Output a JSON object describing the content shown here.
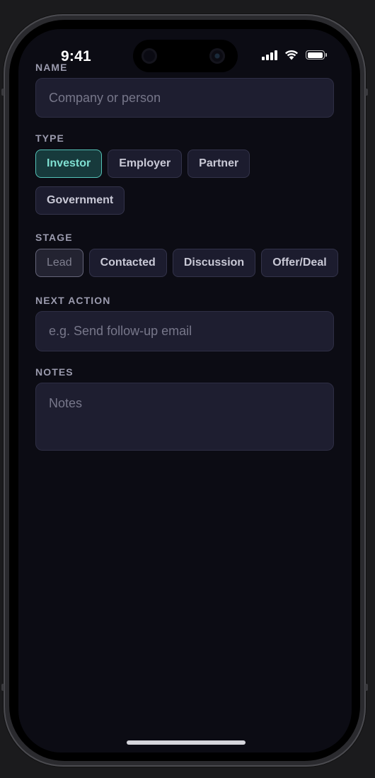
{
  "status": {
    "time": "9:41"
  },
  "form": {
    "name": {
      "label": "NAME",
      "placeholder": "Company or person"
    },
    "type": {
      "label": "TYPE",
      "options": [
        "Investor",
        "Employer",
        "Partner",
        "Government"
      ],
      "selected": "Investor"
    },
    "stage": {
      "label": "STAGE",
      "options": [
        "Lead",
        "Contacted",
        "Discussion",
        "Offer/Deal"
      ],
      "selected": "Lead"
    },
    "next_action": {
      "label": "NEXT ACTION",
      "placeholder": "e.g. Send follow-up email"
    },
    "notes": {
      "label": "NOTES",
      "placeholder": "Notes"
    }
  },
  "colors": {
    "background": "#0c0c14",
    "field": "#1e1e30",
    "accent": "#55c3b8"
  }
}
